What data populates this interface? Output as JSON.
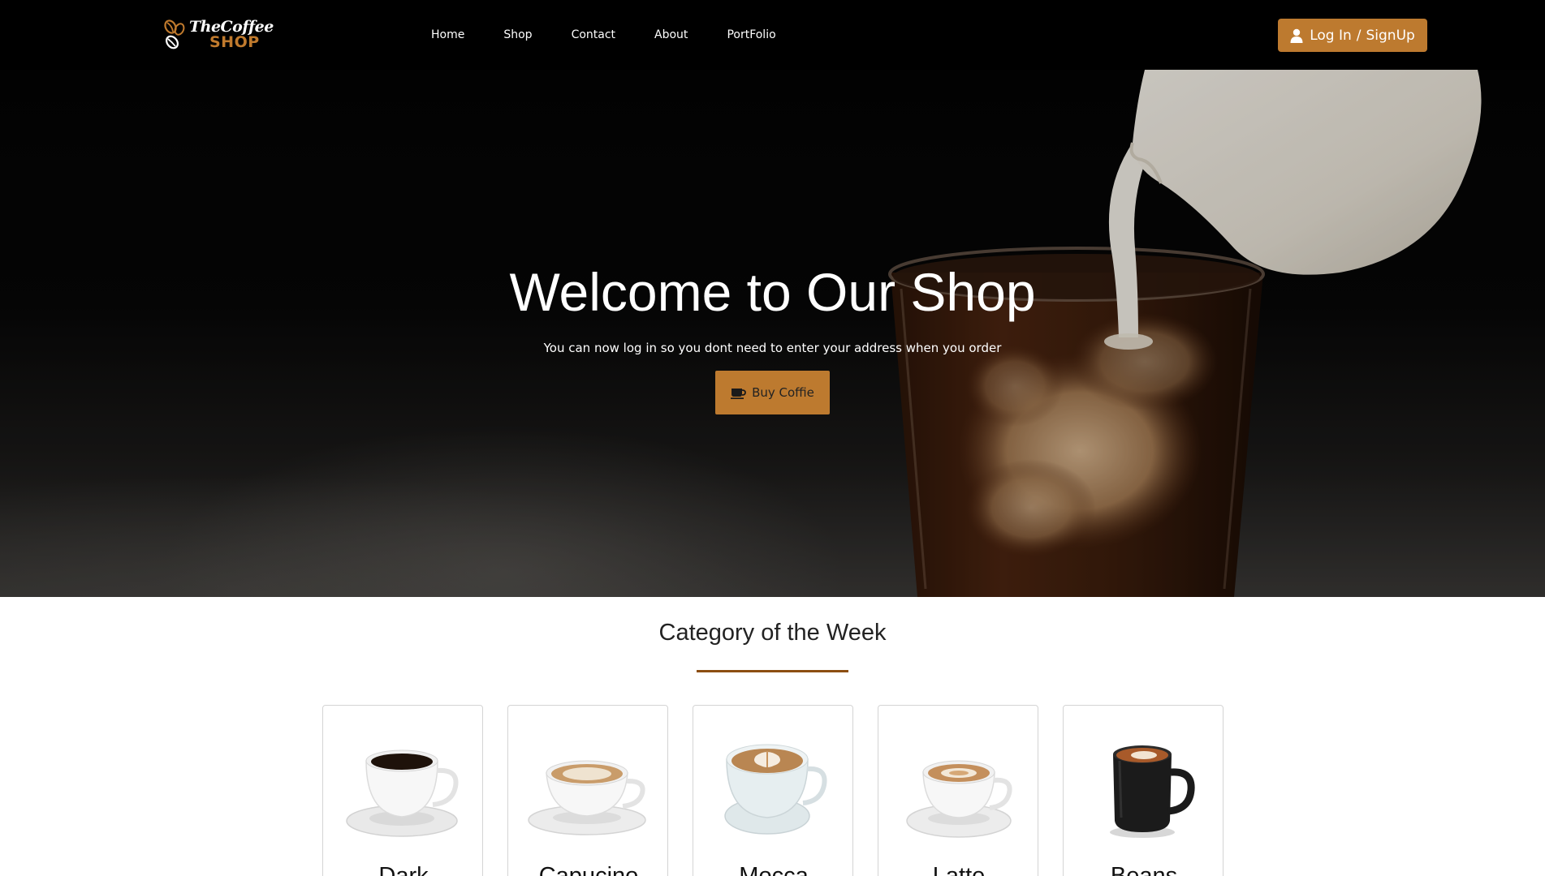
{
  "nav": {
    "logo_line1": "TheCoffee",
    "logo_line2": "SHOP",
    "links": [
      "Home",
      "Shop",
      "Contact",
      "About",
      "PortFolio"
    ],
    "login_label": "Log In",
    "login_sep": "/",
    "signup_label": "SignUp"
  },
  "hero": {
    "title": "Welcome to Our Shop",
    "subtitle": "You can now log in so you dont need to enter your address when you order",
    "button_label": "Buy Coffie"
  },
  "category": {
    "title": "Category of the Week",
    "items": [
      {
        "label": "Dark",
        "icon": "dark-coffee-cup"
      },
      {
        "label": "Capucino",
        "icon": "cappuccino-cup"
      },
      {
        "label": "Mocca",
        "icon": "mocca-cup"
      },
      {
        "label": "Latte",
        "icon": "latte-cup"
      },
      {
        "label": "Beans",
        "icon": "black-mug"
      }
    ]
  },
  "colors": {
    "accent": "#bd7a2f",
    "underline": "#8c4e12",
    "navbar": "#000000"
  }
}
